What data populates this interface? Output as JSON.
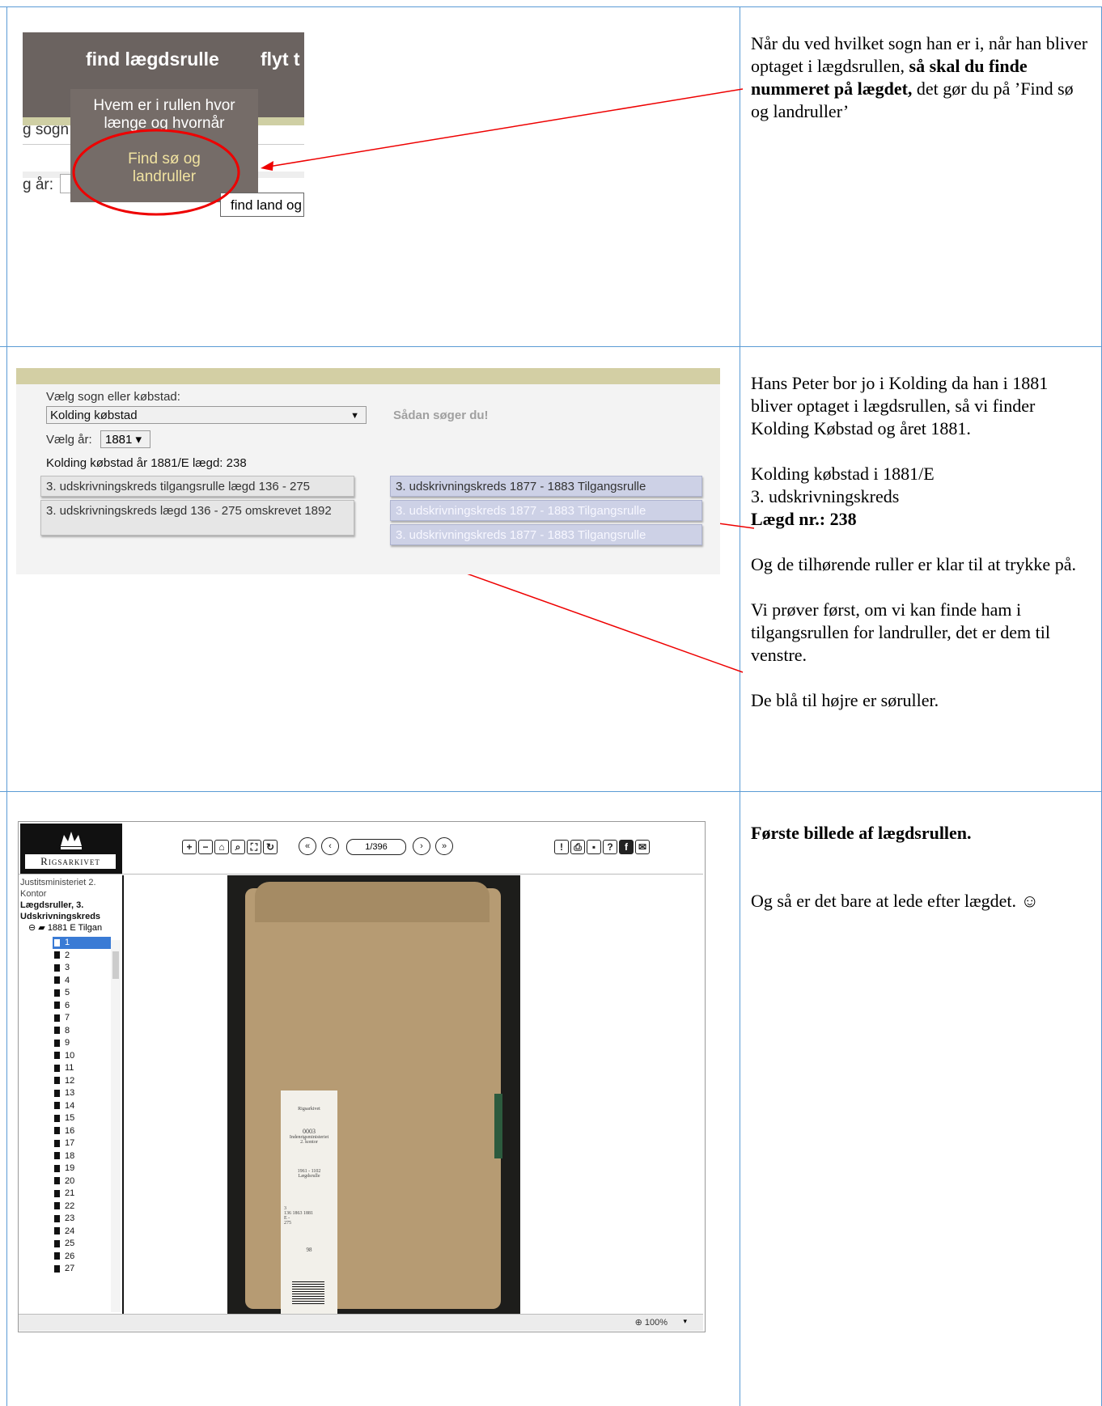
{
  "panel1": {
    "menu_title": "find lægdsrulle",
    "menu_title2": "flyt t",
    "dropdown_item1": "Hvem er i rullen hvor længe og hvornår",
    "dropdown_item2": "Find sø og landruller",
    "left_fragment1": "g sogn",
    "left_fragment2": "g år:",
    "tooltip": "find land og",
    "note": {
      "text1": "Når du ved hvilket sogn han er i, når han bliver optaget i lægdsrullen, ",
      "bold": "så skal du finde nummeret på lægdet,",
      "text2": " det gør du på ’Find sø og landruller’"
    }
  },
  "panel2": {
    "select_label": "Vælg sogn eller købstad:",
    "select_value": "Kolding købstad",
    "help_link": "Sådan søger du!",
    "year_label": "Vælg år:",
    "year_value": "1881 ▾",
    "result_line": "Kolding købstad år 1881/E lægd: 238",
    "land_buttons": [
      "3. udskrivningskreds tilgangsrulle lægd 136 - 275",
      "3. udskrivningskreds lægd 136 - 275 omskrevet 1892"
    ],
    "sea_buttons": [
      "3. udskrivningskreds 1877 - 1883 Tilgangsrulle",
      "3. udskrivningskreds 1877 - 1883 Tilgangsrulle",
      "3. udskrivningskreds 1877 - 1883 Tilgangsrulle"
    ],
    "note": {
      "p1": "Hans Peter bor jo i Kolding da han i 1881 bliver optaget i lægdsrullen, så vi finder Kolding Købstad og året 1881.",
      "p2_line1": "Kolding købstad i 1881/E",
      "p2_line2": "3. udskrivningskreds",
      "p2_line3": "Lægd nr.: 238",
      "p3": "Og de tilhørende ruller er klar til at trykke på.",
      "p4": "Vi prøver først, om vi kan finde ham i tilgangsrullen for landruller, det er dem til venstre.",
      "p5": "De blå til højre er søruller."
    }
  },
  "panel3": {
    "logo_text": "Rigsarkivet",
    "tree_line1": "Justitsministeriet 2. Kontor",
    "tree_line2": "Lægdsruller, 3. Udskrivningskreds",
    "tree_folder": "1881 E Tilgan",
    "tree_items": [
      "1",
      "2",
      "3",
      "4",
      "5",
      "6",
      "7",
      "8",
      "9",
      "10",
      "11",
      "12",
      "13",
      "14",
      "15",
      "16",
      "17",
      "18",
      "19",
      "20",
      "21",
      "22",
      "23",
      "24",
      "25",
      "26",
      "27"
    ],
    "page_counter": "1/396",
    "zoom": "100%",
    "label_lines": [
      "Rigsarkivet",
      "0003",
      "Indenrigsministeriet",
      "2. kontor",
      "1961 - 1102",
      "Lægdsrulle",
      "3",
      "136  1863  1881",
      "E -",
      "275",
      "98"
    ],
    "note": {
      "title": "Første billede af lægdsrullen.",
      "text": "Og så er det bare at lede efter lægdet. ☺"
    }
  }
}
